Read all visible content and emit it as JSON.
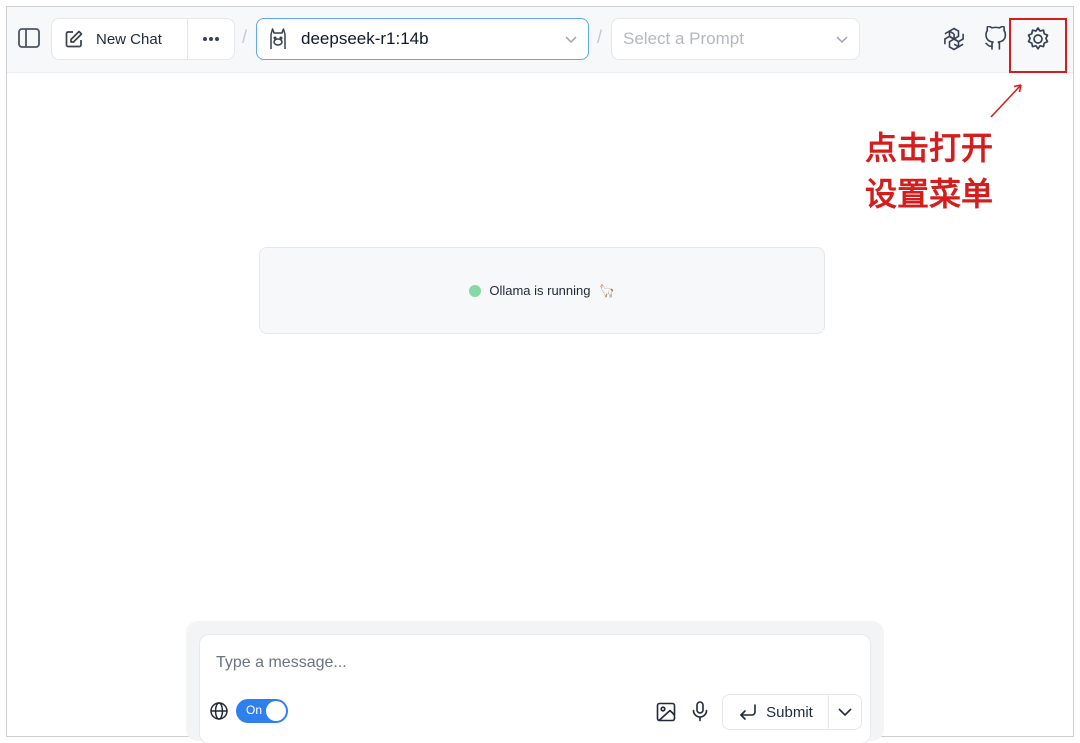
{
  "header": {
    "new_chat_label": "New Chat",
    "more_label": "···",
    "separator": "/",
    "model_label": "deepseek-r1:14b",
    "prompt_placeholder": "Select a Prompt"
  },
  "annotation": {
    "line1": "点击打开",
    "line2": "设置菜单",
    "color": "#d41e1e"
  },
  "status": {
    "text": "Ollama is running",
    "emoji": "🦙",
    "dot_color": "#86d9a4"
  },
  "composer": {
    "placeholder": "Type a message...",
    "toggle_label": "On",
    "submit_label": "Submit",
    "accent": "#2f80ed"
  },
  "icons": [
    "sidebar-toggle-icon",
    "edit-icon",
    "more-icon",
    "llama-model-icon",
    "chevron-down-icon",
    "openai-icon",
    "github-icon",
    "settings-gear-icon",
    "globe-icon",
    "image-icon",
    "microphone-icon",
    "enter-arrow-icon"
  ]
}
